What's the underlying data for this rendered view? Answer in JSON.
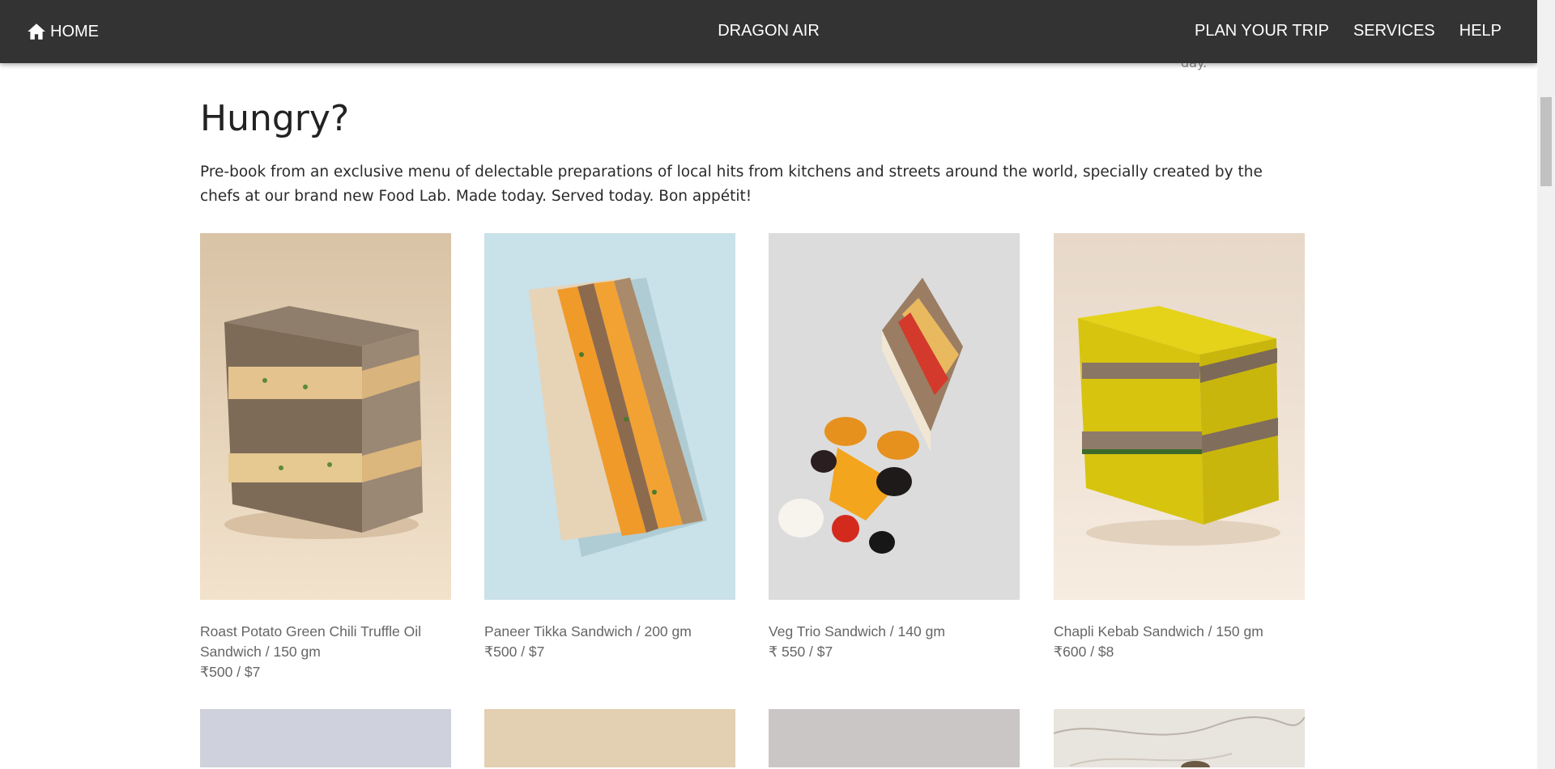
{
  "nav": {
    "home_label": "HOME",
    "brand": "DRAGON AIR",
    "links": [
      "PLAN YOUR TRIP",
      "SERVICES",
      "HELP"
    ]
  },
  "stray_text": "day.",
  "section": {
    "title": "Hungry?",
    "intro": "Pre-book from an exclusive menu of delectable preparations of local hits from kitchens and streets around the world, specially created by the chefs at our brand new Food Lab. Made today. Served today. Bon appétit!"
  },
  "items": [
    {
      "title": "Roast Potato Green Chili Truffle Oil Sandwich / 150 gm",
      "price": "₹500 / $7",
      "image": "sandwich-brown-stacked"
    },
    {
      "title": "Paneer Tikka Sandwich / 200 gm",
      "price": "₹500 / $7",
      "image": "sandwich-triangle-orange"
    },
    {
      "title": "Veg Trio Sandwich / 140 gm",
      "price": "₹ 550 / $7",
      "image": "sandwich-with-fruits"
    },
    {
      "title": "Chapli Kebab Sandwich / 150 gm",
      "price": "₹600 / $8",
      "image": "sandwich-yellow-stacked"
    }
  ]
}
